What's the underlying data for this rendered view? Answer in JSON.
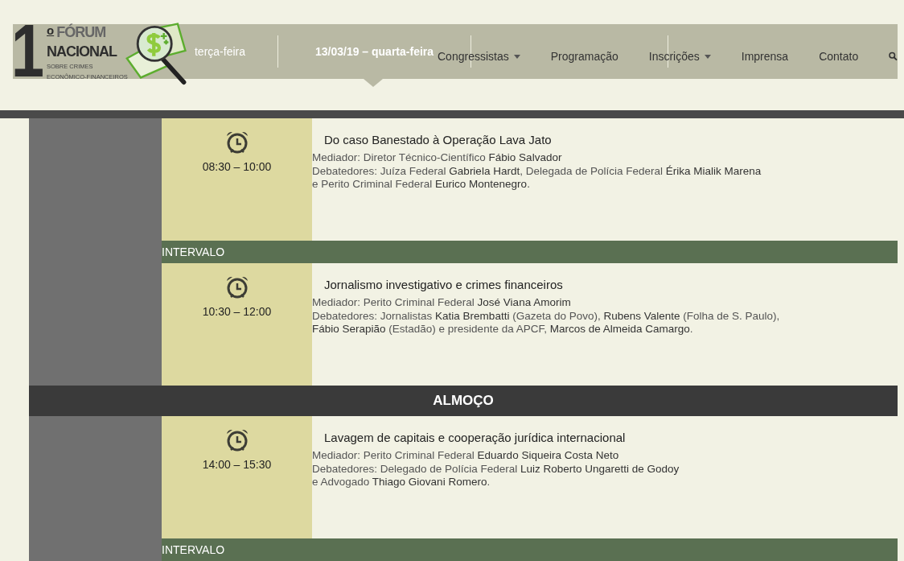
{
  "logo": {
    "number": "1",
    "ordinal": "o",
    "line1": "FÓRUM",
    "line2": "NACIONAL",
    "line3": "SOBRE CRIMES",
    "line4": "ECONÔMICO-FINANCEIROS"
  },
  "day_tabs": [
    {
      "label": "terça-feira",
      "selected": false
    },
    {
      "label": "13/03/19 – quarta-feira",
      "selected": true
    }
  ],
  "nav": [
    {
      "label": "Congressistas",
      "dropdown": true
    },
    {
      "label": "Programação",
      "dropdown": false
    },
    {
      "label": "Inscrições",
      "dropdown": true
    },
    {
      "label": "Imprensa",
      "dropdown": false
    },
    {
      "label": "Contato",
      "dropdown": false
    }
  ],
  "schedule": [
    {
      "kind": "session",
      "time": "08:30 – 10:00",
      "title": "Do caso Banestado à Operação Lava Jato",
      "lines": [
        "Mediador: Diretor Técnico-Científico **Fábio Salvador**",
        "Debatedores: Juíza Federal **Gabriela Hardt**, Delegada de Polícia Federal **Érika Mialik Marena**",
        "e Perito Criminal Federal **Eurico Montenegro**."
      ]
    },
    {
      "kind": "interval",
      "label": "INTERVALO"
    },
    {
      "kind": "session",
      "time": "10:30 – 12:00",
      "title": "Jornalismo investigativo e crimes financeiros",
      "lines": [
        "Mediador: Perito Criminal Federal **José Viana Amorim**",
        "Debatedores: Jornalistas **Katia Brembatti** (Gazeta do Povo), **Rubens Valente** (Folha de S. Paulo),",
        "**Fábio Serapião** (Estadão) e presidente da APCF, **Marcos de Almeida Camargo**."
      ]
    },
    {
      "kind": "lunch",
      "label": "ALMOÇO"
    },
    {
      "kind": "session",
      "time": "14:00 – 15:30",
      "title": "Lavagem de capitais e cooperação jurídica internacional",
      "lines": [
        "Mediador: Perito Criminal Federal **Eduardo Siqueira Costa Neto**",
        "Debatedores: Delegado de Polícia Federal **Luiz Roberto Ungaretti de Godoy**",
        "e Advogado **Thiago Giovani Romero**."
      ]
    },
    {
      "kind": "interval",
      "label": "INTERVALO"
    }
  ]
}
